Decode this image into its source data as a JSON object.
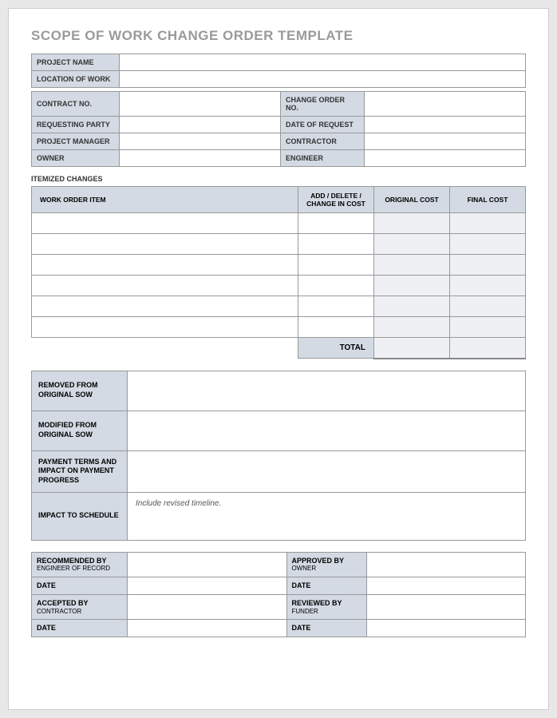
{
  "title": "SCOPE OF WORK CHANGE ORDER TEMPLATE",
  "header": {
    "project_name_label": "PROJECT NAME",
    "project_name_value": "",
    "location_label": "LOCATION OF WORK",
    "location_value": "",
    "contract_no_label": "CONTRACT NO.",
    "contract_no_value": "",
    "change_order_no_label": "CHANGE ORDER NO.",
    "change_order_no_value": "",
    "requesting_party_label": "REQUESTING PARTY",
    "requesting_party_value": "",
    "date_of_request_label": "DATE OF REQUEST",
    "date_of_request_value": "",
    "project_manager_label": "PROJECT MANAGER",
    "project_manager_value": "",
    "contractor_label": "CONTRACTOR",
    "contractor_value": "",
    "owner_label": "OWNER",
    "owner_value": "",
    "engineer_label": "ENGINEER",
    "engineer_value": ""
  },
  "itemized": {
    "section_title": "ITEMIZED CHANGES",
    "col_work_order": "WORK ORDER ITEM",
    "col_add_delete": "ADD / DELETE / CHANGE IN COST",
    "col_original": "ORIGINAL COST",
    "col_final": "FINAL COST",
    "rows": [
      {
        "item": "",
        "change": "",
        "original": "",
        "final": ""
      },
      {
        "item": "",
        "change": "",
        "original": "",
        "final": ""
      },
      {
        "item": "",
        "change": "",
        "original": "",
        "final": ""
      },
      {
        "item": "",
        "change": "",
        "original": "",
        "final": ""
      },
      {
        "item": "",
        "change": "",
        "original": "",
        "final": ""
      },
      {
        "item": "",
        "change": "",
        "original": "",
        "final": ""
      }
    ],
    "total_label": "TOTAL",
    "total_original": "",
    "total_final": ""
  },
  "details": {
    "removed_label": "REMOVED FROM ORIGINAL SOW",
    "removed_value": "",
    "modified_label": "MODIFIED FROM ORIGINAL SOW",
    "modified_value": "",
    "payment_label": "PAYMENT TERMS AND IMPACT ON PAYMENT PROGRESS",
    "payment_value": "",
    "schedule_label": "IMPACT TO SCHEDULE",
    "schedule_value": "Include revised timeline."
  },
  "signatures": {
    "recommended_label": "RECOMMENDED BY",
    "recommended_sub": "ENGINEER OF RECORD",
    "recommended_value": "",
    "approved_label": "APPROVED BY",
    "approved_sub": "OWNER",
    "approved_value": "",
    "date1_label": "DATE",
    "date1_left": "",
    "date1_right": "",
    "accepted_label": "ACCEPTED BY",
    "accepted_sub": "CONTRACTOR",
    "accepted_value": "",
    "reviewed_label": "REVIEWED BY",
    "reviewed_sub": "FUNDER",
    "reviewed_value": "",
    "date2_label": "DATE",
    "date2_left": "",
    "date2_right": ""
  }
}
